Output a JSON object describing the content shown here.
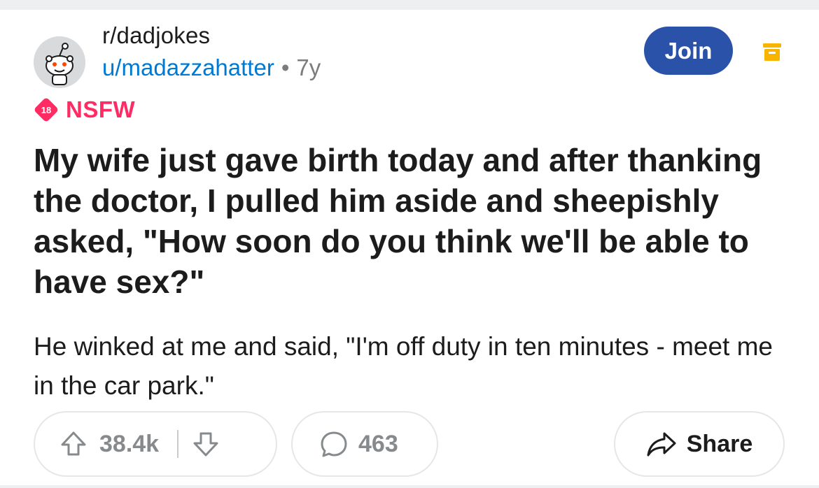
{
  "post": {
    "subreddit": "r/dadjokes",
    "author": "u/madazzahatter",
    "separator": "•",
    "age": "7y",
    "join_label": "Join",
    "nsfw_badge": "18",
    "nsfw_label": "NSFW",
    "title": "My wife just gave birth today and after thanking the doctor, I pulled him aside and sheepishly asked, \"How soon do you think we'll be able to have sex?\"",
    "body": "He winked at me and said, \"I'm off duty in ten minutes - meet me in the car park.\""
  },
  "actions": {
    "vote_count": "38.4k",
    "comment_count": "463",
    "share_label": "Share"
  },
  "icons": {
    "avatar": "snoo-avatar-icon",
    "save": "save-icon",
    "nsfw": "nsfw-18-icon",
    "upvote": "upvote-arrow-icon",
    "downvote": "downvote-arrow-icon",
    "comment": "comment-bubble-icon",
    "share": "share-arrow-icon"
  },
  "colors": {
    "join_button": "#2a52a8",
    "author_link": "#0079d3",
    "nsfw": "#ff2b62",
    "save_icon": "#f7b500"
  }
}
